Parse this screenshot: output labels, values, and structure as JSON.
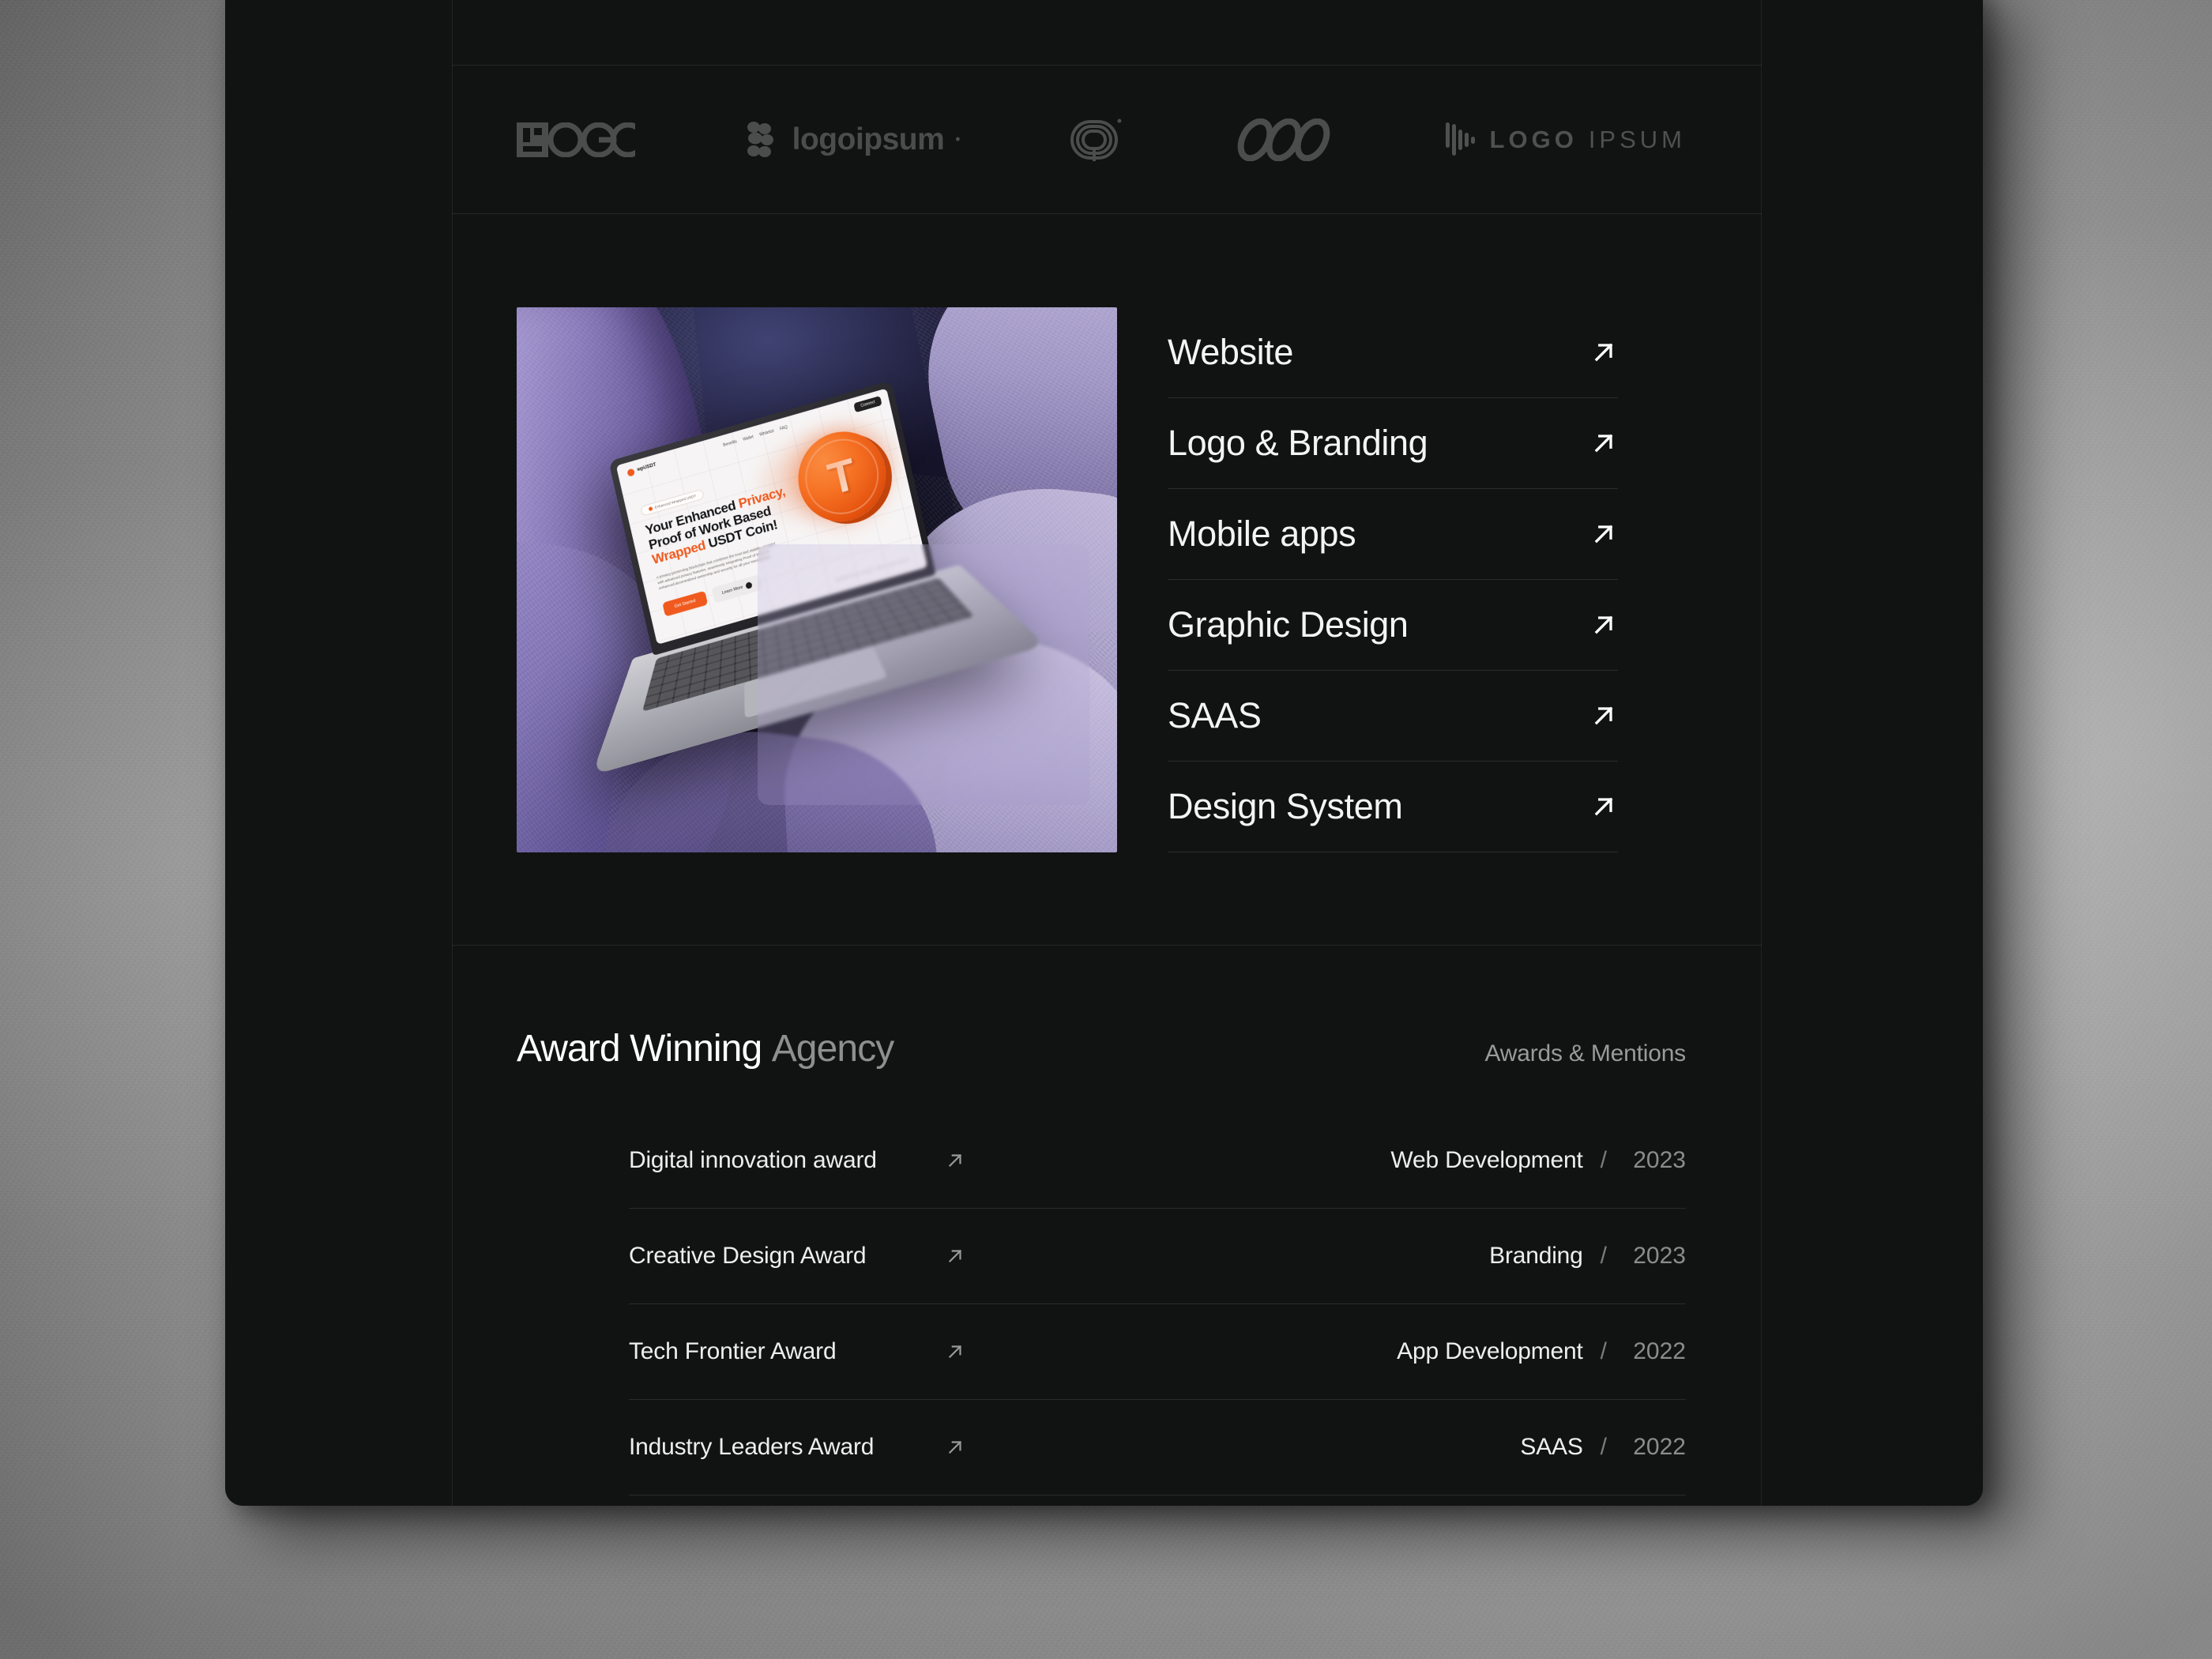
{
  "logos": [
    {
      "name": "logo-mark-logo-blocks",
      "text": "OGO",
      "style": "blocks"
    },
    {
      "name": "logo-mark-logoipsum-wave",
      "text": "logoipsum",
      "style": "wave",
      "sup": "•"
    },
    {
      "name": "logo-mark-spiral",
      "text": "",
      "style": "spiral"
    },
    {
      "name": "logo-mark-infinity-loops",
      "text": "",
      "style": "loops"
    },
    {
      "name": "logo-mark-bars-logoipsum",
      "text_bold": "LOGO",
      "text_thin": "IPSUM",
      "style": "bars"
    }
  ],
  "showcase": {
    "artwork": {
      "alt": "Laptop mockup on purple rocks showing a crypto landing page",
      "screen": {
        "brand": "wpUSDT",
        "nav": [
          "Benefits",
          "Wallet",
          "Whitelist",
          "FAQ"
        ],
        "cta": "Connect",
        "pill": "Enhanced Wrapped USDT",
        "headline_line1": "Your Enhanced ",
        "headline_accent1": "Privacy,",
        "headline_line2": "Proof of Work Based",
        "headline_accent2": "Wrapped",
        "headline_line3": " USDT Coin!",
        "subcopy": "A privacy-preserving blockchain that combines the trust and stability of USDT with advanced privacy features, seamlessly integrating Proof of Work for enhanced decentralized ownership and security for all your transactions.",
        "btn_primary": "Get Started",
        "btn_secondary": "Learn More",
        "coin_symbol": "T",
        "watermark": "WRAPPED USDT  WPUSDT2024"
      }
    },
    "services": [
      {
        "label": "Website",
        "icon": "arrow-up-right-icon"
      },
      {
        "label": "Logo & Branding",
        "icon": "arrow-up-right-icon"
      },
      {
        "label": "Mobile apps",
        "icon": "arrow-up-right-icon"
      },
      {
        "label": "Graphic Design",
        "icon": "arrow-up-right-icon"
      },
      {
        "label": "SAAS",
        "icon": "arrow-up-right-icon"
      },
      {
        "label": "Design System",
        "icon": "arrow-up-right-icon"
      }
    ]
  },
  "awards": {
    "title_strong": "Award Winning",
    "title_muted": "Agency",
    "kicker": "Awards & Mentions",
    "separator": "/",
    "rows": [
      {
        "name": "Digital innovation award",
        "category": "Web Development",
        "year": "2023"
      },
      {
        "name": "Creative Design Award",
        "category": "Branding",
        "year": "2023"
      },
      {
        "name": "Tech Frontier Award",
        "category": "App Development",
        "year": "2022"
      },
      {
        "name": "Industry Leaders Award",
        "category": "SAAS",
        "year": "2022"
      }
    ]
  },
  "colors": {
    "card_bg": "#111312",
    "text_primary": "#f4f4f4",
    "text_muted": "#8f8f8f",
    "accent_orange": "#f05a1e",
    "rule": "rgba(255,255,255,0.11)"
  }
}
